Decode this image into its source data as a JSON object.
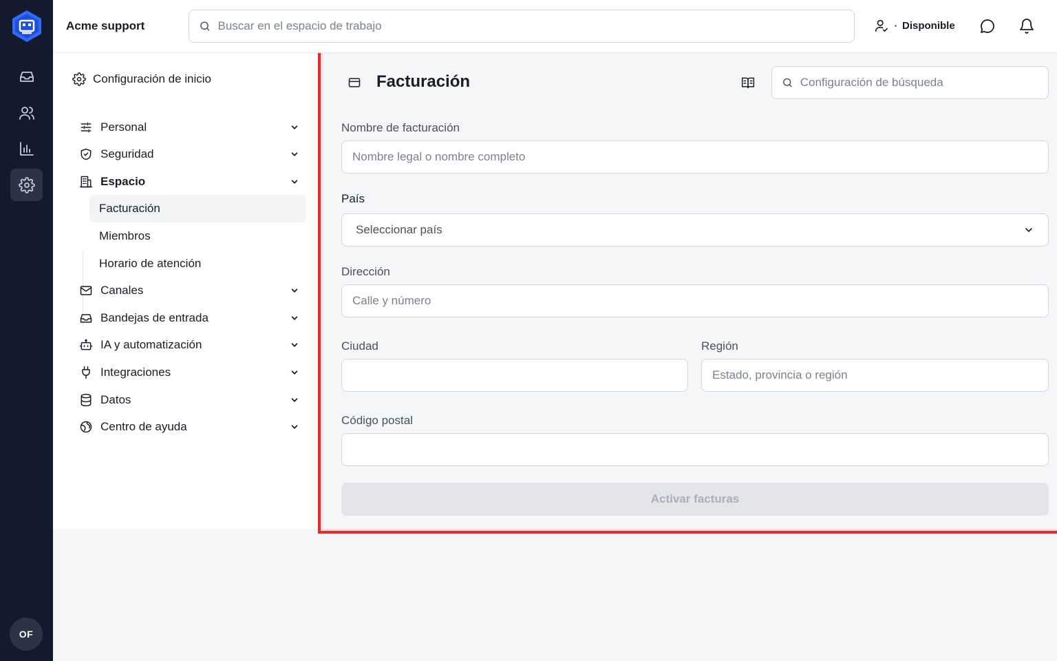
{
  "app": {
    "workspace_name": "Acme support",
    "search_placeholder": "Buscar en el espacio de trabajo",
    "status": "Disponible",
    "user_initials": "OF",
    "colors": {
      "rail": "#141a2e",
      "accent": "#2f6bff",
      "highlight": "#e42c2c"
    }
  },
  "rail": {
    "items": [
      {
        "icon": "inbox-icon",
        "active": false
      },
      {
        "icon": "users-icon",
        "active": false
      },
      {
        "icon": "bar-chart-icon",
        "active": false
      },
      {
        "icon": "gear-icon",
        "active": true
      }
    ]
  },
  "nav": {
    "home_label": "Configuración de inicio",
    "items": [
      {
        "label": "Personal",
        "icon": "sliders-icon"
      },
      {
        "label": "Seguridad",
        "icon": "shield-check-icon"
      },
      {
        "label": "Espacio",
        "icon": "building-icon",
        "expanded": true
      },
      {
        "label": "Canales",
        "icon": "mail-icon"
      },
      {
        "label": "Bandejas de entrada",
        "icon": "inbox-icon"
      },
      {
        "label": "IA y automatización",
        "icon": "bot-icon"
      },
      {
        "label": "Integraciones",
        "icon": "plug-icon"
      },
      {
        "label": "Datos",
        "icon": "database-icon"
      },
      {
        "label": "Centro de ayuda",
        "icon": "globe-icon"
      }
    ],
    "sub_items": [
      {
        "label": "Facturación",
        "active": true
      },
      {
        "label": "Miembros",
        "active": false
      },
      {
        "label": "Horario de atención",
        "active": false
      }
    ]
  },
  "page": {
    "title": "Facturación",
    "search_placeholder": "Configuración de búsqueda",
    "fields": {
      "billing_name": {
        "label": "Nombre de facturación",
        "placeholder": "Nombre legal o nombre completo",
        "value": ""
      },
      "country": {
        "label": "País",
        "selected": "Seleccionar país"
      },
      "address": {
        "label": "Dirección",
        "placeholder": "Calle y número",
        "value": ""
      },
      "city": {
        "label": "Ciudad",
        "placeholder": "",
        "value": ""
      },
      "region": {
        "label": "Región",
        "placeholder": "Estado, provincia o región",
        "value": ""
      },
      "postal_code": {
        "label": "Código postal",
        "placeholder": "",
        "value": ""
      }
    },
    "submit_label": "Activar facturas"
  }
}
